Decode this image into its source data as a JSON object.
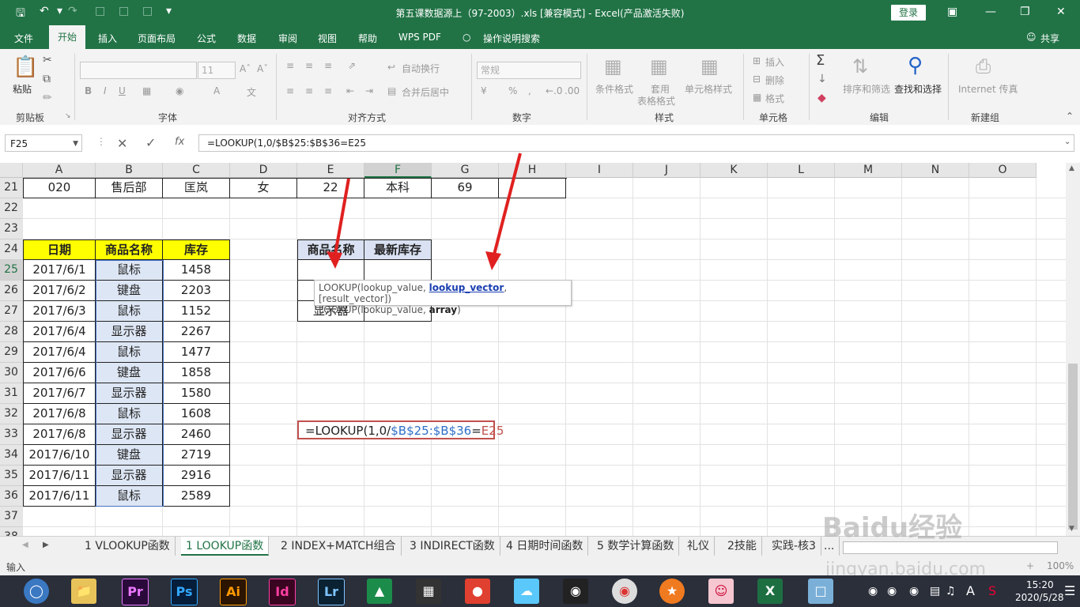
{
  "window": {
    "title": "第五课数据源上（97-2003）.xls  [兼容模式]  -  Excel(产品激活失败)",
    "login_label": "登录",
    "share_label": "共享"
  },
  "menu": [
    "文件",
    "开始",
    "插入",
    "页面布局",
    "公式",
    "数据",
    "审阅",
    "视图",
    "帮助",
    "WPS PDF"
  ],
  "tell_me": "操作说明搜索",
  "ribbon": {
    "paste": "粘贴",
    "font_size": "11",
    "wrap_text": "自动换行",
    "merge_center": "合并后居中",
    "number_format": "常规",
    "conditional_format": "条件格式",
    "table_format_1": "套用",
    "table_format_2": "表格格式",
    "cell_style": "单元格样式",
    "insert": "插入",
    "delete": "删除",
    "format": "格式",
    "sort_filter": "排序和筛选",
    "find_select": "查找和选择",
    "internet_fax": "Internet 传真",
    "groups": {
      "clipboard": "剪贴板",
      "font": "字体",
      "alignment": "对齐方式",
      "number": "数字",
      "styles": "样式",
      "cells": "单元格",
      "editing": "编辑",
      "new_group": "新建组"
    }
  },
  "formula_bar": {
    "name_box": "F25",
    "formula": "=LOOKUP(1,0/$B$25:$B$36=E25"
  },
  "columns": [
    "A",
    "B",
    "C",
    "D",
    "E",
    "F",
    "G",
    "H",
    "I",
    "J",
    "K",
    "L",
    "M",
    "N",
    "O"
  ],
  "rows": [
    "21",
    "22",
    "23",
    "24",
    "25",
    "26",
    "27",
    "28",
    "29",
    "30",
    "31",
    "32",
    "33",
    "34",
    "35",
    "36",
    "37",
    "38"
  ],
  "row21": [
    "020",
    "售后部",
    "匡岚",
    "女",
    "22",
    "本科",
    "69"
  ],
  "table_headers": [
    "日期",
    "商品名称",
    "库存"
  ],
  "table_rows": [
    [
      "2017/6/1",
      "鼠标",
      "1458"
    ],
    [
      "2017/6/2",
      "键盘",
      "2203"
    ],
    [
      "2017/6/3",
      "鼠标",
      "1152"
    ],
    [
      "2017/6/4",
      "显示器",
      "2267"
    ],
    [
      "2017/6/4",
      "鼠标",
      "1477"
    ],
    [
      "2017/6/6",
      "键盘",
      "1858"
    ],
    [
      "2017/6/7",
      "显示器",
      "1580"
    ],
    [
      "2017/6/8",
      "鼠标",
      "1608"
    ],
    [
      "2017/6/8",
      "显示器",
      "2460"
    ],
    [
      "2017/6/10",
      "键盘",
      "2719"
    ],
    [
      "2017/6/11",
      "显示器",
      "2916"
    ],
    [
      "2017/6/11",
      "鼠标",
      "2589"
    ]
  ],
  "lookup_table": {
    "headers": [
      "商品名称",
      "最新库存"
    ],
    "last_item": "显示器"
  },
  "edit_cell": {
    "part1": "=LOOKUP(1,0/",
    "part2": "$B$25:$B$36",
    "part3": "=",
    "part4": "E25"
  },
  "tooltip": {
    "line1_a": "LOOKUP(lookup_value, ",
    "line1_b": "lookup_vector",
    "line1_c": ", [result_vector])",
    "line2_a": "LOOKUP(lookup_value, ",
    "line2_b": "array",
    "line2_c": ")"
  },
  "sheet_tabs": [
    "1 VLOOKUP函数",
    "1 LOOKUP函数",
    "2 INDEX+MATCH组合",
    "3 INDIRECT函数",
    "4 日期时间函数",
    "5 数学计算函数",
    "礼仪",
    "2技能",
    "实践-核3",
    "..."
  ],
  "status": {
    "mode": "输入",
    "zoom": "100%"
  },
  "taskbar": {
    "time": "15:20",
    "date": "2020/5/28",
    "ime": "A"
  },
  "watermark": "Baidu经验",
  "watermark_sub": "jingyan.baidu.com",
  "colors": {
    "excel_green": "#217346",
    "arrow_red": "#e02020"
  }
}
